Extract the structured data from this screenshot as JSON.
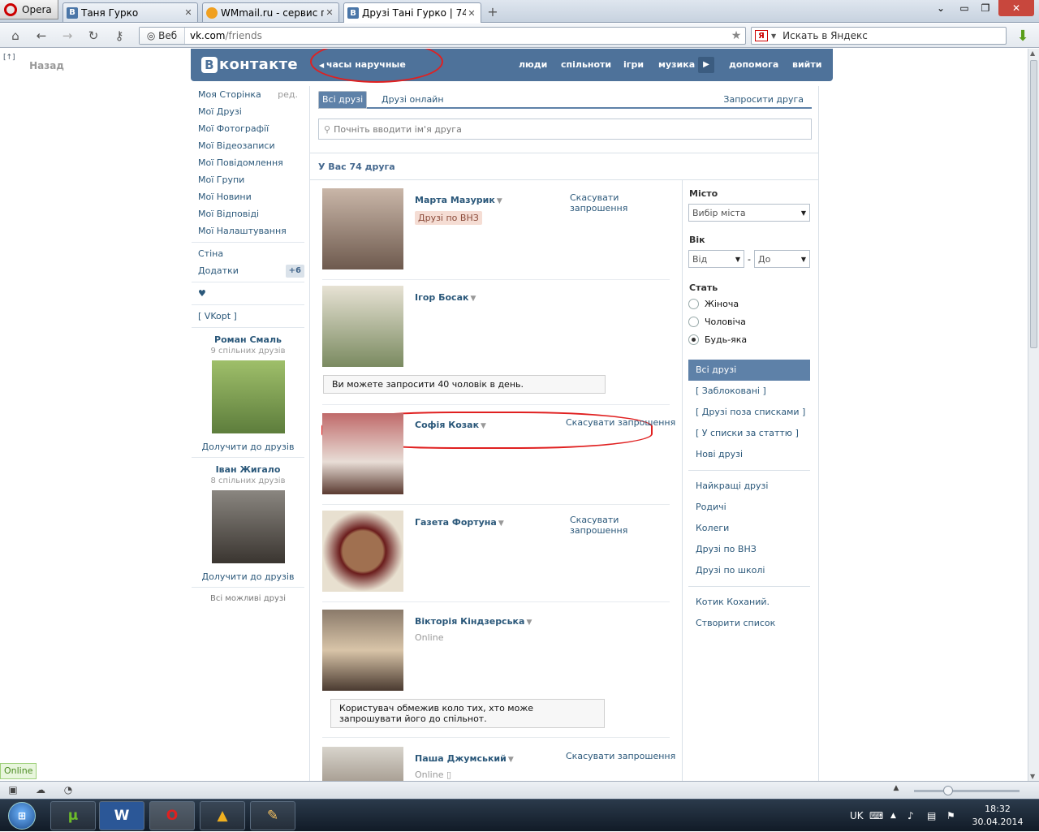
{
  "browser": {
    "menu_label": "Opera",
    "tabs": [
      {
        "title": "Таня Гурко",
        "favicon": "vk-icon"
      },
      {
        "title": "WMmail.ru - сервис п...",
        "favicon": "wmmail-icon"
      },
      {
        "title": "Друзі Тані Гурко | 74 д...",
        "favicon": "vk-icon"
      }
    ],
    "new_tab": "+",
    "address": {
      "segment": "Веб",
      "host": "vk.com",
      "path": "/friends"
    },
    "search_placeholder": "Искать в Яндекс",
    "yandex_letter": "Я"
  },
  "page": {
    "back_bracket": "[↑]",
    "back_label": "Назад",
    "logo_letter": "В",
    "logo_text": "контакте",
    "status": "часы наручные",
    "nav": [
      "люди",
      "спільноти",
      "ігри",
      "музика",
      "допомога",
      "вийти"
    ],
    "left_menu": [
      {
        "label": "Моя Сторінка",
        "extra": "ред."
      },
      {
        "label": "Мої Друзі"
      },
      {
        "label": "Мої Фотографії"
      },
      {
        "label": "Мої Відеозаписи"
      },
      {
        "label": "Мої Повідомлення"
      },
      {
        "label": "Мої Групи"
      },
      {
        "label": "Мої Новини"
      },
      {
        "label": "Мої Відповіді"
      },
      {
        "label": "Мої Налаштування"
      }
    ],
    "left_menu_2": [
      {
        "label": "Стіна"
      },
      {
        "label": "Додатки",
        "badge": "+6"
      }
    ],
    "heart": "♥",
    "vkopt": "[ VKopt ]",
    "suggestions": [
      {
        "name": "Роман Смаль",
        "mutual": "9 спільних друзів",
        "add": "Долучити до друзів"
      },
      {
        "name": "Іван Жигало",
        "mutual": "8 спільних друзів",
        "add": "Долучити до друзів"
      }
    ],
    "all_possible": "Всі можливі друзі",
    "tabs": [
      "Всі друзі",
      "Друзі онлайн"
    ],
    "invite_friend": "Запросити друга",
    "search_placeholder": "Почніть вводити ім'я друга",
    "count_label": "У Вас 74 друга",
    "friends": [
      {
        "name": "Марта Мазурик",
        "action": "Скасувати запрошення",
        "tag": "Друзі по ВНЗ"
      },
      {
        "name": "Ігор Босак",
        "notice": "Ви можете запросити 40 чоловік в день."
      },
      {
        "name": "Софія Козак",
        "action": "Скасувати запрошення"
      },
      {
        "name": "Газета Фортуна",
        "action": "Скасувати запрошення"
      },
      {
        "name": "Вікторія Кіндзерська",
        "online": "Online",
        "notice": "Користувач обмежив коло тих, хто може запрошувати його до спільнот."
      },
      {
        "name": "Паша Джумський",
        "action": "Скасувати запрошення",
        "online": "Online"
      }
    ],
    "filter": {
      "city_label": "Місто",
      "city_value": "Вибір міста",
      "age_label": "Вік",
      "age_from": "Від",
      "age_dash": "-",
      "age_to": "До",
      "sex_label": "Стать",
      "sex_options": [
        "Жіноча",
        "Чоловіча",
        "Будь-яка"
      ],
      "sex_selected": 2
    },
    "lists_1": [
      "Всі друзі",
      "[ Заблоковані ]",
      "[ Друзі поза списками ]",
      "[ У списки за статтю ]",
      "Нові друзі"
    ],
    "lists_2": [
      "Найкращі друзі",
      "Родичі",
      "Колеги",
      "Друзі по ВНЗ",
      "Друзі по школі"
    ],
    "lists_3": [
      "Котик Коханий.",
      "Створити список"
    ]
  },
  "online_badge": "Online",
  "taskbar": {
    "start_label": "⊞",
    "lang": "UK",
    "time": "18:32",
    "date": "30.04.2014"
  },
  "colors": {
    "vk_blue": "#4e729a",
    "link": "#2b587a",
    "annotation_red": "#e02020"
  }
}
